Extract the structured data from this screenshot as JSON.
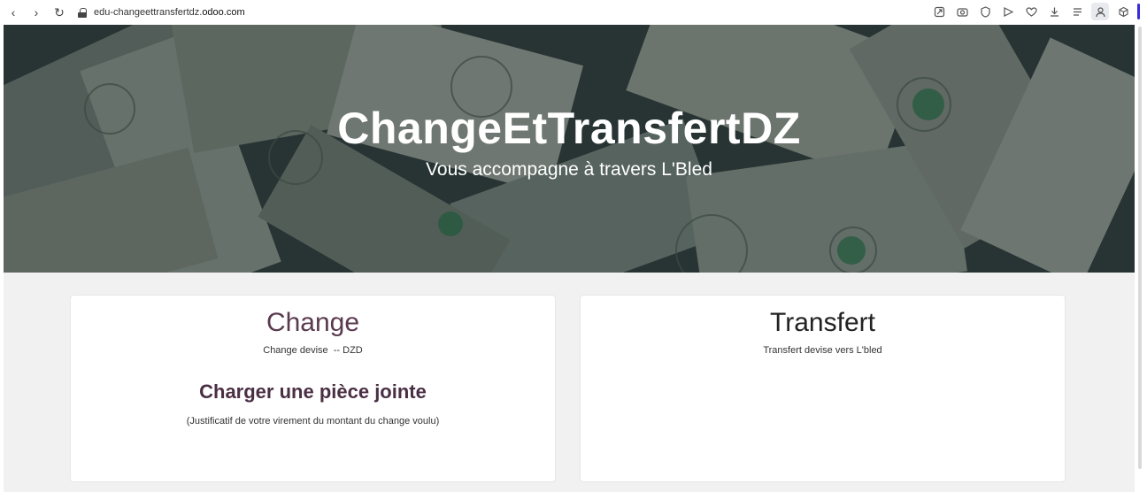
{
  "browser": {
    "url_prefix": "edu-changeettransfertdz.",
    "url_domain": "odoo.com",
    "nav": {
      "back": "‹",
      "forward": "›",
      "reload": "↻"
    }
  },
  "hero": {
    "title": "ChangeEtTransfertDZ",
    "subtitle": "Vous accompagne à travers L'Bled"
  },
  "cards": {
    "change": {
      "title": "Change",
      "description": "Change devise  -- DZD",
      "attach_title": "Charger une pièce jointe",
      "attach_note": "(Justificatif de votre virement du montant du change voulu)"
    },
    "transfert": {
      "title": "Transfert",
      "description": "Transfert devise vers L'bled"
    }
  },
  "colors": {
    "accent": "#3b2bd6",
    "change_title": "#5a3a4e",
    "attach_title": "#4a2f44",
    "content_bg": "#f2f1f1"
  },
  "icons": [
    "share-icon",
    "camera-icon",
    "shield-icon",
    "send-icon",
    "heart-icon",
    "download-icon",
    "list-icon",
    "profile-icon",
    "extensions-icon"
  ]
}
